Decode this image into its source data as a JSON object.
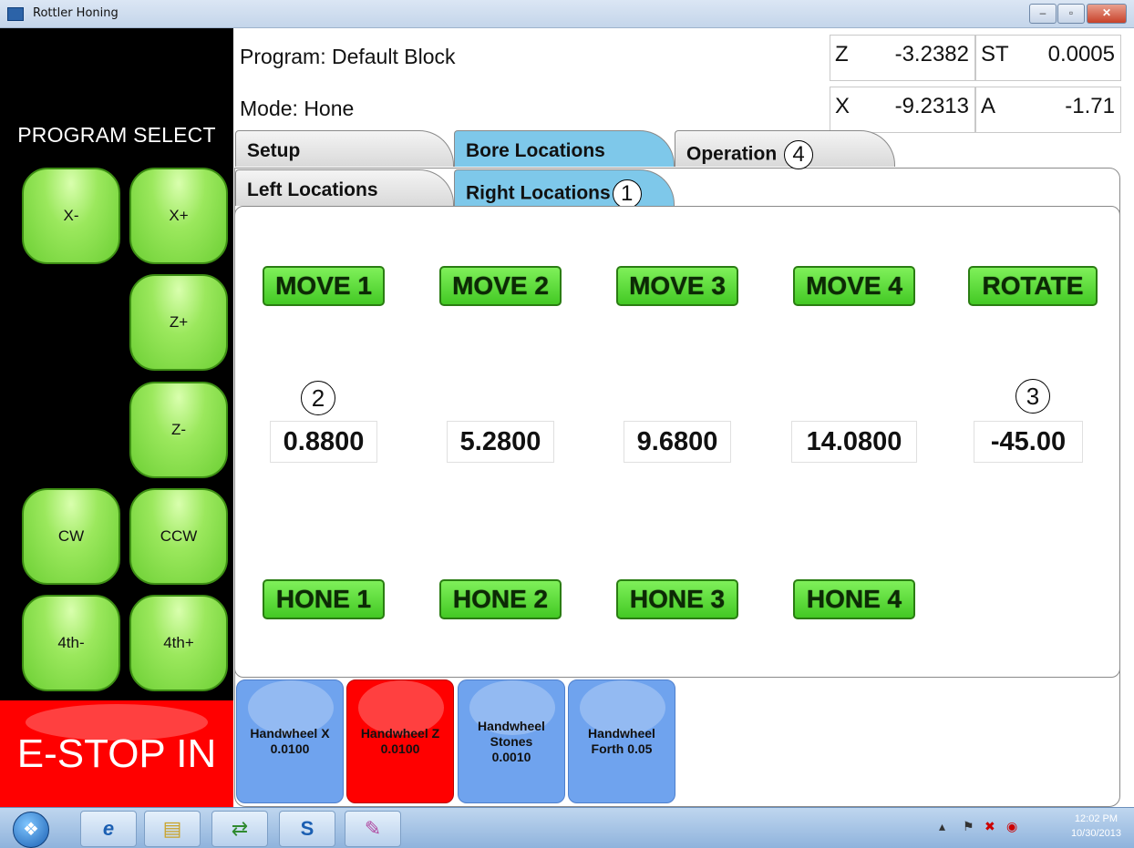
{
  "window": {
    "title": "Rottler Honing",
    "minimize": "–",
    "maximize": "▫",
    "close": "✕"
  },
  "left": {
    "program_select": "PROGRAM SELECT",
    "jog": {
      "x_minus": "X-",
      "x_plus": "X+",
      "z_plus": "Z+",
      "z_minus": "Z-",
      "cw": "CW",
      "ccw": "CCW",
      "fourth_minus": "4th-",
      "fourth_plus": "4th+"
    },
    "estop": "E-STOP IN"
  },
  "header": {
    "program": "Program: Default Block",
    "mode": "Mode: Hone",
    "readouts": {
      "z": {
        "axis": "Z",
        "value": "-3.2382"
      },
      "st": {
        "axis": "ST",
        "value": "0.0005"
      },
      "x": {
        "axis": "X",
        "value": "-9.2313"
      },
      "a": {
        "axis": "A",
        "value": "-1.71"
      }
    }
  },
  "tabs": {
    "setup": "Setup",
    "bore": "Bore Locations",
    "operation": "Operation",
    "operation_marker": "4"
  },
  "subtabs": {
    "left": "Left Locations",
    "right": "Right Locations",
    "right_marker": "1"
  },
  "moves": [
    "MOVE 1",
    "MOVE 2",
    "MOVE 3",
    "MOVE 4",
    "ROTATE"
  ],
  "values": [
    "0.8800",
    "5.2800",
    "9.6800",
    "14.0800",
    "-45.00"
  ],
  "markers": {
    "m2": "2",
    "m3": "3"
  },
  "hones": [
    "HONE 1",
    "HONE 2",
    "HONE 3",
    "HONE 4"
  ],
  "handwheels": {
    "x": {
      "line1": "Handwheel X",
      "line2": "0.0100"
    },
    "z": {
      "line1": "Handwheel Z",
      "line2": "0.0100"
    },
    "stones": {
      "line1": "Handwheel",
      "line2": "Stones",
      "line3": "0.0010"
    },
    "forth": {
      "line1": "Handwheel",
      "line2": "Forth 0.05"
    }
  },
  "colors": {
    "active_tab": "#7ec8ea",
    "green_button": "#5ad83a",
    "estop": "#ff0000",
    "handwheel_blue": "#6fa3ee"
  },
  "taskbar": {
    "time": "12:02 PM",
    "date": "10/30/2013"
  }
}
